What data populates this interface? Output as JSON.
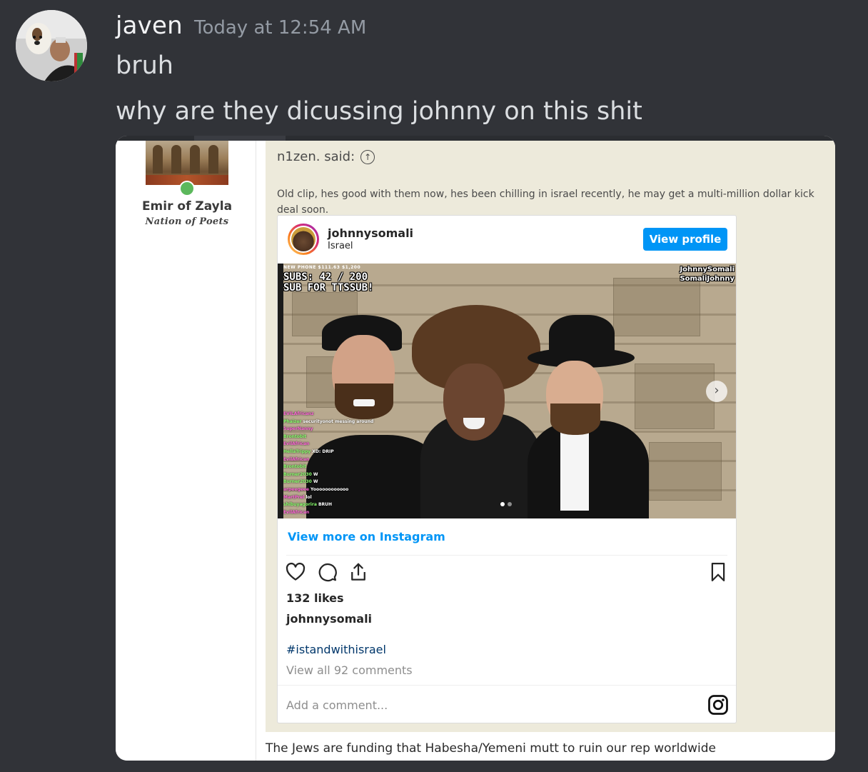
{
  "message": {
    "author": "javen",
    "timestamp": "Today at 12:54 AM",
    "lines": [
      "bruh",
      "why are they dicussing johnny on this shit"
    ]
  },
  "forum": {
    "poster_name": "Emir of Zayla",
    "poster_title": "Nation of Poets",
    "quote_author": "n1zen. said:",
    "quote_text": "Old clip, hes good with them now, hes been chilling in israel recently, he may get a multi-million dollar kick deal soon.",
    "reply_text": "The Jews are funding that Habesha/Yemeni mutt to ruin our rep worldwide"
  },
  "instagram": {
    "username": "johnnysomali",
    "location": "Israel",
    "view_profile_label": "View profile",
    "view_more_label": "View more on Instagram",
    "likes": "132 likes",
    "caption_user": "johnnysomali",
    "hashtag": "#istandwithisrael",
    "comments_label": "View all 92 comments",
    "add_comment_placeholder": "Add a comment...",
    "overlay": {
      "top_stats": "NEW PHONE     $111.63     $1,200",
      "subs_line1": "SUBS: 42 / 200",
      "subs_line2": "SUB FOR TTSSUB!",
      "social_line1": "JohnnySomali",
      "social_line2": "SomaliJohnny"
    },
    "chat": [
      {
        "user": "EVILAfricanz",
        "msg": ""
      },
      {
        "user": "Phaizer",
        "msg": "securityonot messing around"
      },
      {
        "user": "SuperNanny",
        "msg": ""
      },
      {
        "user": "Brontobit",
        "msg": ""
      },
      {
        "user": "EvilAfrican",
        "msg": ""
      },
      {
        "user": "HellaTrippy",
        "msg": "XD: DRIP"
      },
      {
        "user": "EvilAfrican",
        "msg": ""
      },
      {
        "user": "Brontobit",
        "msg": ""
      },
      {
        "user": "Burner2030",
        "msg": "W"
      },
      {
        "user": "Burner2030",
        "msg": "W"
      },
      {
        "user": "arpeegeee",
        "msg": "Yoooooooooooo"
      },
      {
        "user": "MartPrel",
        "msg": "lol"
      },
      {
        "user": "shibuyagorira",
        "msg": "BRUH"
      },
      {
        "user": "EvilAfrican",
        "msg": ""
      }
    ]
  },
  "colors": {
    "discord_bg": "#313338",
    "ig_blue": "#0095f6",
    "quote_bg": "#edeadb",
    "online_green": "#5cb85c"
  }
}
